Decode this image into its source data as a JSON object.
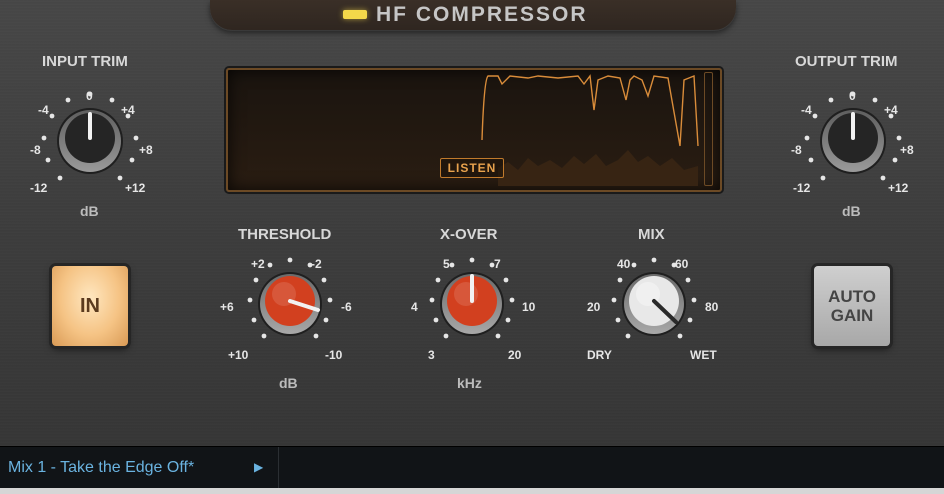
{
  "plugin": {
    "title": "HF COMPRESSOR"
  },
  "input_trim": {
    "label": "INPUT TRIM",
    "ticks": [
      "-4",
      "0",
      "+4",
      "-8",
      "+8",
      "-12",
      "+12"
    ],
    "unit": "dB"
  },
  "output_trim": {
    "label": "OUTPUT TRIM",
    "ticks": [
      "-4",
      "0",
      "+4",
      "-8",
      "+8",
      "-12",
      "+12"
    ],
    "unit": "dB"
  },
  "threshold": {
    "label": "THRESHOLD",
    "ticks": [
      "+2",
      "-2",
      "+6",
      "-6",
      "+10",
      "-10"
    ],
    "unit": "dB"
  },
  "xover": {
    "label": "X-OVER",
    "ticks": [
      "5",
      "7",
      "4",
      "10",
      "3",
      "20"
    ],
    "unit": "kHz"
  },
  "mix": {
    "label": "MIX",
    "ticks": [
      "40",
      "60",
      "20",
      "80",
      "DRY",
      "WET"
    ]
  },
  "display": {
    "listen_label": "LISTEN"
  },
  "buttons": {
    "in_label": "IN",
    "auto_gain_line1": "AUTO",
    "auto_gain_line2": "GAIN"
  },
  "footer": {
    "preset_name": "Mix 1 - Take the Edge Off*",
    "play_glyph": "▶"
  },
  "colors": {
    "accent_orange": "#e8a24d",
    "led_yellow": "#f3d84a",
    "knob_red": "#d2401f",
    "footer_text": "#6ab3e0"
  }
}
